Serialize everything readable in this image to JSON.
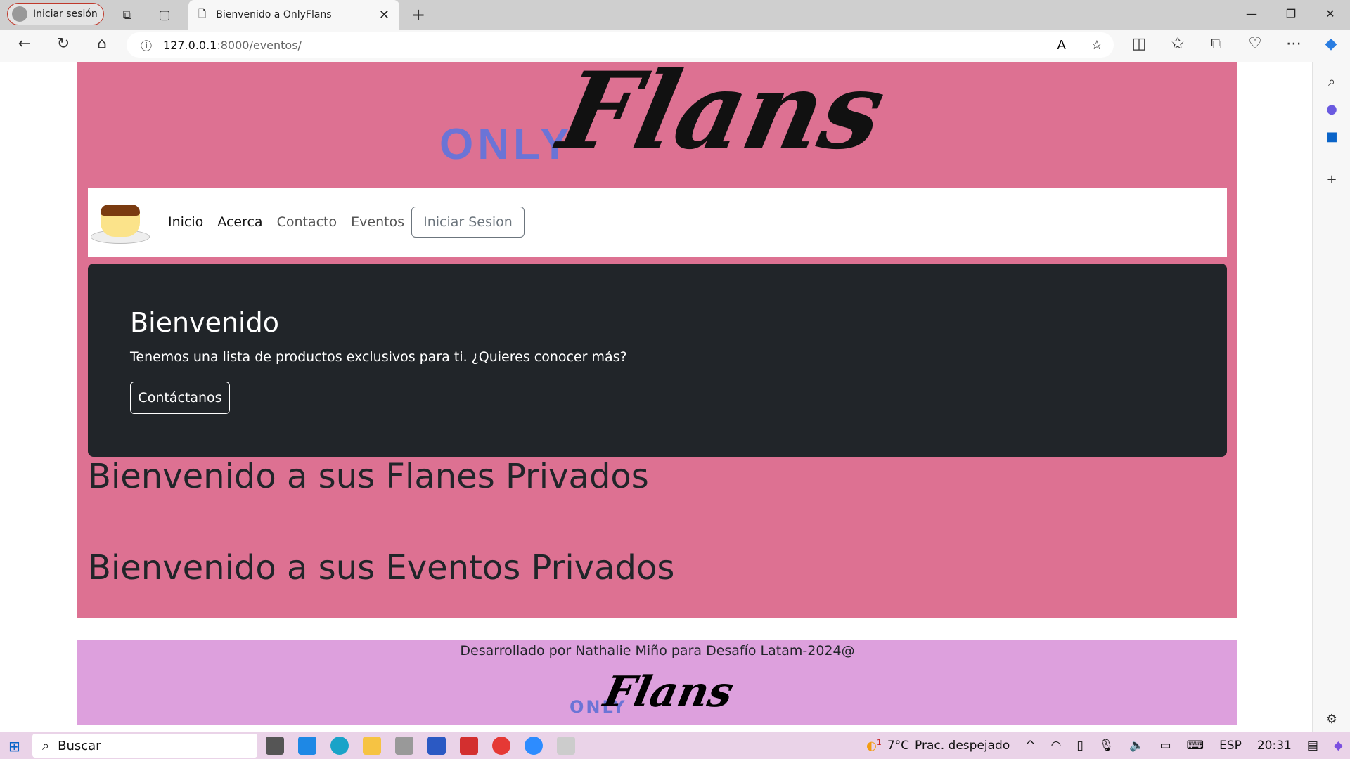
{
  "browser": {
    "profile_label": "Iniciar sesión",
    "tab_title": "Bienvenido a OnlyFlans",
    "url_host": "127.0.0.1",
    "url_path": ":8000/eventos/"
  },
  "header": {
    "logo_only": "ONLY",
    "logo_flans": "Flans"
  },
  "nav": {
    "items": [
      "Inicio",
      "Acerca",
      "Contacto",
      "Eventos"
    ],
    "login": "Iniciar Sesion"
  },
  "jumbotron": {
    "title": "Bienvenido",
    "text": "Tenemos una lista de productos exclusivos para ti. ¿Quieres conocer más?",
    "button": "Contáctanos"
  },
  "main": {
    "heading1": "Bienvenido a sus Flanes Privados",
    "heading2": "Bienvenido a sus Eventos Privados"
  },
  "footer": {
    "text": "Desarrollado por Nathalie Miño para Desafío Latam-2024@",
    "logo_only": "ONLY",
    "logo_flans": "Flans"
  },
  "taskbar": {
    "search": "Buscar",
    "weather": "7°C",
    "weather_desc": "Prac. despejado",
    "lang": "ESP",
    "time": "20:31",
    "badge": "1"
  },
  "colors": {
    "page": "#dd7192",
    "footer": "#dda0dd",
    "jumbo": "#212529"
  }
}
